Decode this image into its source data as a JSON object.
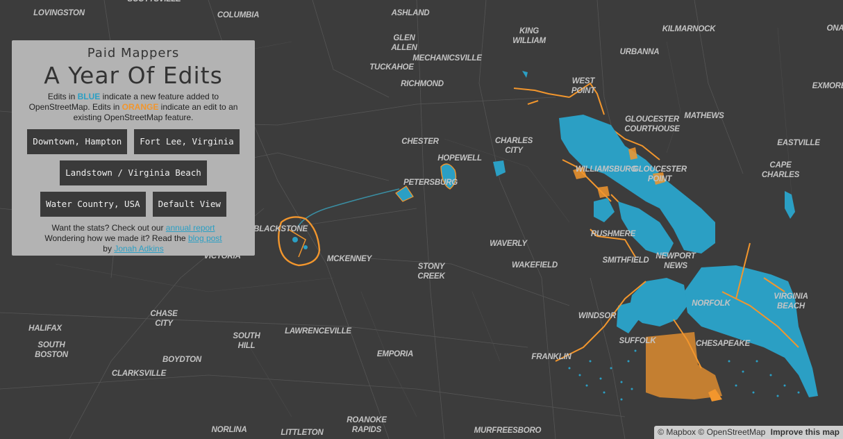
{
  "panel": {
    "subtitle": "Paid Mappers",
    "title": "A Year Of Edits",
    "desc_pre": "Edits in ",
    "desc_blue": "BLUE",
    "desc_mid": " indicate a new feature added to OpenStreetMap. Edits in ",
    "desc_orange": "ORANGE",
    "desc_post": " indicate an edit to an existing OpenStreetMap feature.",
    "buttons_row1": [
      "Downtown, Hampton",
      "Fort Lee, Virginia"
    ],
    "buttons_row2": [
      "Landstown / Virginia Beach"
    ],
    "buttons_row3": [
      "Water Country, USA",
      "Default View"
    ],
    "stats_pre": "Want the stats? Check out our ",
    "stats_link": "annual report",
    "made_pre": "Wondering how we made it? Read the ",
    "made_link": "blog post",
    "by_pre": "by ",
    "by_link": "Jonah Adkins"
  },
  "colors": {
    "new_feature": "#2b9fc4",
    "edited_feature": "#f2962d",
    "map_background": "#3c3c3c",
    "panel_background": "#b3b3b3"
  },
  "places": [
    "SCOTTSVILLE",
    "LOVINGSTON",
    "COLUMBIA",
    "ASHLAND",
    "KING WILLIAM",
    "KILMARNOCK",
    "ONA",
    "GLEN ALLEN",
    "MECHANICSVILLE",
    "URBANNA",
    "TUCKAHOE",
    "WEST POINT",
    "EXMORE",
    "RICHMOND",
    "GLOUCESTER COURTHOUSE",
    "MATHEWS",
    "CHESTER",
    "CHARLES CITY",
    "EASTVILLE",
    "HOPEWELL",
    "WILLIAMSBURG",
    "GLOUCESTER POINT",
    "CAPE CHARLES",
    "PETERSBURG",
    "BLACKSTONE",
    "RUSHMERE",
    "WAVERLY",
    "SMITHFIELD",
    "NEWPORT NEWS",
    "VICTORIA",
    "MCKENNEY",
    "STONY CREEK",
    "WAKEFIELD",
    "NORFOLK",
    "VIRGINIA BEACH",
    "WINDSOR",
    "CHASE CITY",
    "HALIFAX",
    "SOUTH HILL",
    "LAWRENCEVILLE",
    "SUFFOLK",
    "CHESAPEAKE",
    "SOUTH BOSTON",
    "BOYDTON",
    "EMPORIA",
    "FRANKLIN",
    "CLARKSVILLE",
    "NORLINA",
    "LITTLETON",
    "ROANOKE RAPIDS",
    "MURFREESBORO"
  ],
  "attribution": {
    "mapbox": "© Mapbox",
    "osm": "© OpenStreetMap",
    "improve": "Improve this map"
  }
}
